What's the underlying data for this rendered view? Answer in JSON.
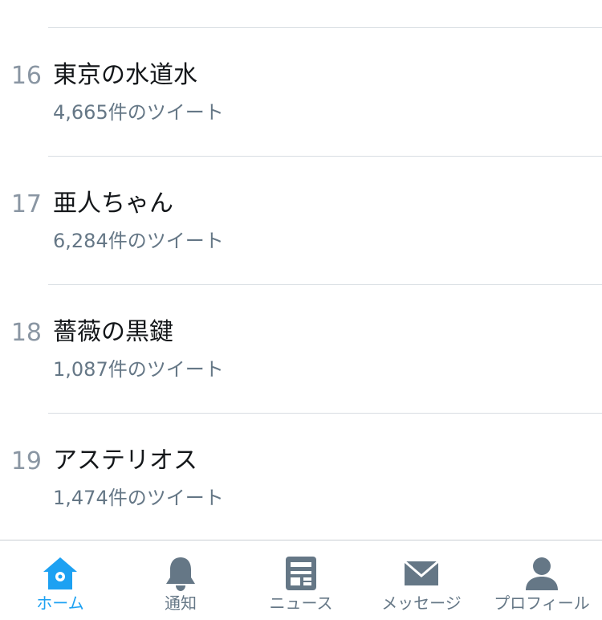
{
  "trends": [
    {
      "rank": "16",
      "name": "東京の水道水",
      "count": "4,665件のツイート"
    },
    {
      "rank": "17",
      "name": "亜人ちゃん",
      "count": "6,284件のツイート"
    },
    {
      "rank": "18",
      "name": "薔薇の黒鍵",
      "count": "1,087件のツイート"
    },
    {
      "rank": "19",
      "name": "アステリオス",
      "count": "1,474件のツイート"
    }
  ],
  "tabs": [
    {
      "label": "ホーム",
      "icon": "home-icon",
      "active": true
    },
    {
      "label": "通知",
      "icon": "bell-icon",
      "active": false
    },
    {
      "label": "ニュース",
      "icon": "news-icon",
      "active": false
    },
    {
      "label": "メッセージ",
      "icon": "envelope-icon",
      "active": false
    },
    {
      "label": "プロフィール",
      "icon": "person-icon",
      "active": false
    }
  ],
  "colors": {
    "accent": "#1da1f2",
    "icon_inactive": "#657786",
    "rank_text": "#8a96a3",
    "primary_text": "#14171a",
    "secondary_text": "#657786",
    "divider": "#d8dde2"
  }
}
